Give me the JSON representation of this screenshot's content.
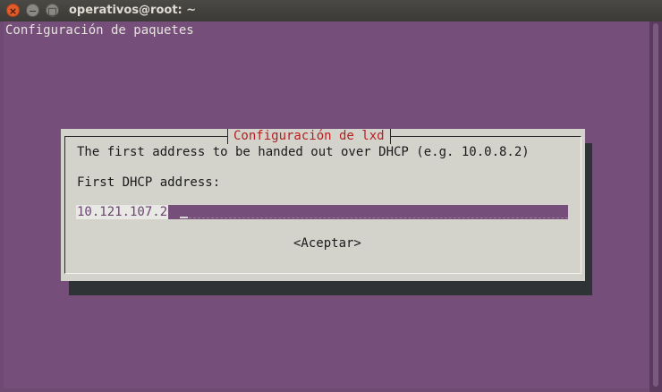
{
  "window": {
    "title": "operativos@root: ~",
    "close_glyph": "×",
    "minimize_glyph": "−",
    "maximize_glyph": "□"
  },
  "terminal": {
    "header": "Configuración de paquetes"
  },
  "dialog": {
    "title": "Configuración de lxd",
    "description": "The first address to be handed out over DHCP (e.g. 10.0.8.2)",
    "field_label": "First DHCP address:",
    "field_value": "10.121.107.2",
    "ok_label": "<Aceptar>"
  },
  "colors": {
    "terminal_bg": "#754f79",
    "dialog_bg": "#d3d3cc",
    "dialog_title": "#b51f1f",
    "close_button": "#e25b2a"
  }
}
